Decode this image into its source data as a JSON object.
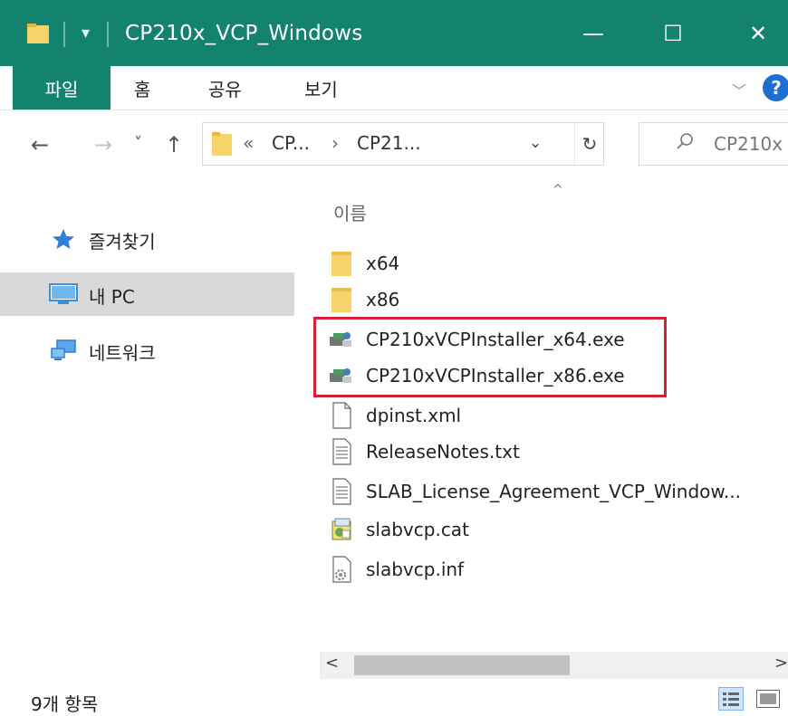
{
  "window": {
    "title": "CP210x_VCP_Windows",
    "controls": {
      "minimize": "—",
      "maximize": "☐",
      "close": "✕"
    },
    "pin_glyph": "▾"
  },
  "ribbon": {
    "tabs": [
      {
        "label": "파일",
        "active": true
      },
      {
        "label": "홈",
        "active": false
      },
      {
        "label": "공유",
        "active": false
      },
      {
        "label": "보기",
        "active": false
      }
    ],
    "expand_glyph": "﹀",
    "help_label": "?"
  },
  "address": {
    "back": "←",
    "forward": "→",
    "recent": "˅",
    "up": "↑",
    "overflow": "«",
    "crumbs": [
      "CP...",
      "CP21..."
    ],
    "crumb_sep": "›",
    "dropdown": "⌄",
    "refresh": "↻"
  },
  "search": {
    "placeholder": "CP210x",
    "icon": "search-icon"
  },
  "nav_pane": {
    "items": [
      {
        "label": "즐겨찾기",
        "icon": "star-icon",
        "selected": false
      },
      {
        "label": "내 PC",
        "icon": "computer-icon",
        "selected": true
      },
      {
        "label": "네트워크",
        "icon": "network-icon",
        "selected": false
      }
    ]
  },
  "file_list": {
    "column_header": "이름",
    "sort_glyph": "^",
    "files": [
      {
        "name": "x64",
        "icon": "folder-icon"
      },
      {
        "name": "x86",
        "icon": "folder-icon"
      },
      {
        "name": "CP210xVCPInstaller_x64.exe",
        "icon": "installer-icon"
      },
      {
        "name": "CP210xVCPInstaller_x86.exe",
        "icon": "installer-icon"
      },
      {
        "name": "dpinst.xml",
        "icon": "blank-file-icon"
      },
      {
        "name": "ReleaseNotes.txt",
        "icon": "text-file-icon"
      },
      {
        "name": "SLAB_License_Agreement_VCP_Window...",
        "icon": "text-file-icon"
      },
      {
        "name": "slabvcp.cat",
        "icon": "catalog-file-icon"
      },
      {
        "name": "slabvcp.inf",
        "icon": "settings-file-icon"
      }
    ]
  },
  "scrollbar": {
    "left": "<",
    "right": ">"
  },
  "status": {
    "item_count": "9개 항목"
  },
  "colors": {
    "titlebar": "#13836f",
    "highlight_border": "#d02333",
    "selected_nav": "#d9d9d9"
  }
}
